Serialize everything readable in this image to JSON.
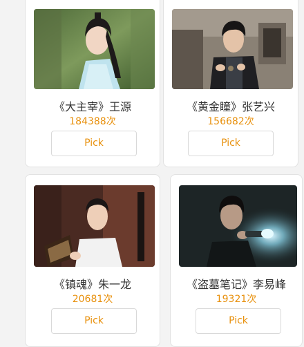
{
  "cards": [
    {
      "title": "《大主宰》王源",
      "count": "184388次",
      "button": "Pick",
      "photo": "young man in light-blue hanfu with long black hair, green outdoor background"
    },
    {
      "title": "《黄金瞳》张艺兴",
      "count": "156682次",
      "button": "Pick",
      "photo": "man in black leather jacket holding a stone, old stone building background"
    },
    {
      "title": "《镇魂》朱一龙",
      "count": "20681次",
      "button": "Pick",
      "photo": "man in white shirt holding an old book, dark wooden interior"
    },
    {
      "title": "《盗墓笔记》李易峰",
      "count": "19321次",
      "button": "Pick",
      "photo": "man in dark tomb holding a flashlight"
    }
  ],
  "colors": {
    "accent": "#e8900c",
    "background": "#f3f3f3",
    "card": "#ffffff"
  }
}
